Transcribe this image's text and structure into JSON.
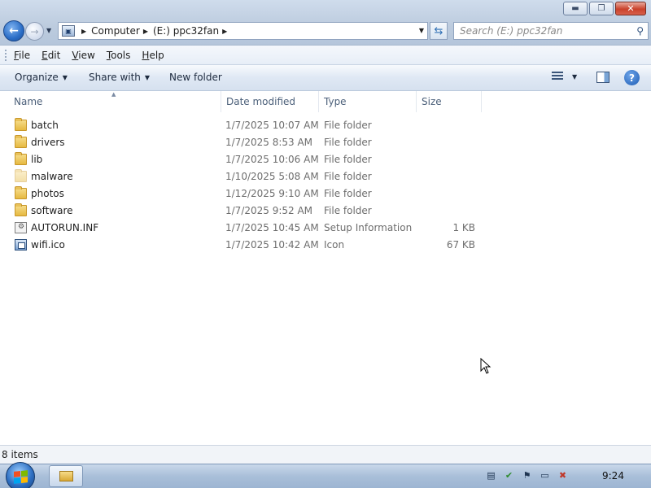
{
  "window": {
    "controls": {
      "minimize": "▬",
      "maximize": "❐",
      "close": "✕"
    }
  },
  "nav": {
    "breadcrumbs": [
      "Computer",
      "(E:) ppc32fan"
    ],
    "search_placeholder": "Search (E:) ppc32fan"
  },
  "menu": [
    {
      "key": "F",
      "rest": "ile"
    },
    {
      "key": "E",
      "rest": "dit"
    },
    {
      "key": "V",
      "rest": "iew"
    },
    {
      "key": "T",
      "rest": "ools"
    },
    {
      "key": "H",
      "rest": "elp"
    }
  ],
  "toolbar": {
    "organize": "Organize",
    "share_with": "Share with",
    "new_folder": "New folder"
  },
  "columns": {
    "name": "Name",
    "date": "Date modified",
    "type": "Type",
    "size": "Size"
  },
  "files": [
    {
      "name": "batch",
      "date": "1/7/2025 10:07 AM",
      "type": "File folder",
      "size": "",
      "icon": "folder-icon"
    },
    {
      "name": "drivers",
      "date": "1/7/2025 8:53 AM",
      "type": "File folder",
      "size": "",
      "icon": "folder-icon"
    },
    {
      "name": "lib",
      "date": "1/7/2025 10:06 AM",
      "type": "File folder",
      "size": "",
      "icon": "folder-icon"
    },
    {
      "name": "malware",
      "date": "1/10/2025 5:08 AM",
      "type": "File folder",
      "size": "",
      "icon": "folder-faded-icon"
    },
    {
      "name": "photos",
      "date": "1/12/2025 9:10 AM",
      "type": "File folder",
      "size": "",
      "icon": "folder-icon"
    },
    {
      "name": "software",
      "date": "1/7/2025 9:52 AM",
      "type": "File folder",
      "size": "",
      "icon": "folder-icon"
    },
    {
      "name": "AUTORUN.INF",
      "date": "1/7/2025 10:45 AM",
      "type": "Setup Information",
      "size": "1 KB",
      "icon": "setup-file-icon"
    },
    {
      "name": "wifi.ico",
      "date": "1/7/2025 10:42 AM",
      "type": "Icon",
      "size": "67 KB",
      "icon": "ico-file-icon"
    }
  ],
  "status": {
    "item_count": "8 items"
  },
  "taskbar": {
    "clock": "9:24"
  },
  "colors": {
    "window_frame": "#bccbde",
    "toolbar": "#dfe8f4",
    "folder": "#e6b941",
    "taskbar": "#a9bfd9"
  }
}
